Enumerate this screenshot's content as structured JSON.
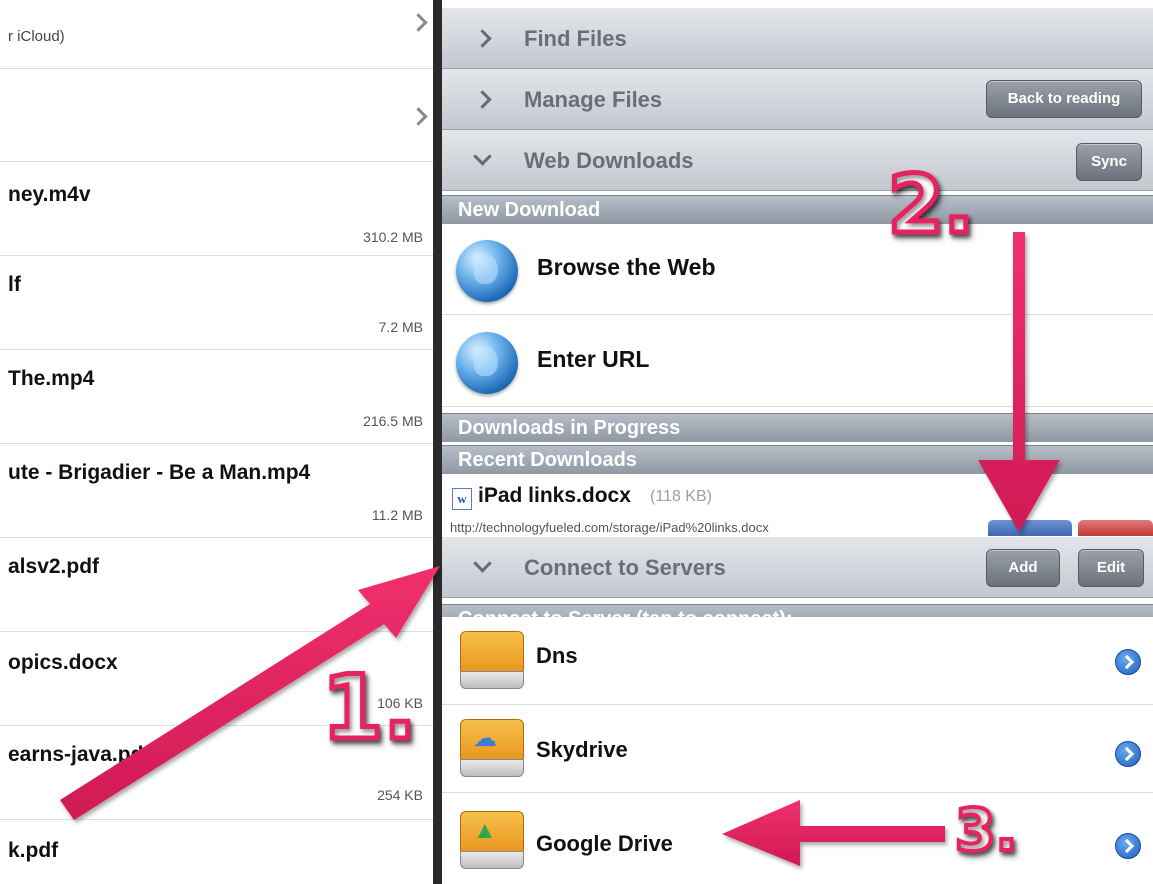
{
  "left_list": {
    "rows": [
      {
        "title": "",
        "sub": "r iCloud)",
        "size": "",
        "chevron": true
      },
      {
        "title": "",
        "sub": "",
        "size": "",
        "chevron": true
      },
      {
        "title": "ney.m4v",
        "sub": "",
        "size": "310.2 MB",
        "chevron": false
      },
      {
        "title": "lf",
        "sub": "",
        "size": "7.2 MB",
        "chevron": false
      },
      {
        "title": "The.mp4",
        "sub": "",
        "size": "216.5 MB",
        "chevron": false
      },
      {
        "title": "ute - Brigadier - Be a Man.mp4",
        "sub": "",
        "size": "11.2 MB",
        "chevron": false
      },
      {
        "title": "alsv2.pdf",
        "sub": "",
        "size": "",
        "chevron": false
      },
      {
        "title": "opics.docx",
        "sub": "",
        "size": "106 KB",
        "chevron": false
      },
      {
        "title": "earns-java.pdf",
        "sub": "",
        "size": "254 KB",
        "chevron": false
      },
      {
        "title": "k.pdf",
        "sub": "",
        "size": "",
        "chevron": false
      }
    ]
  },
  "bars": {
    "find_files": "Find Files",
    "manage_files": "Manage Files",
    "web_downloads": "Web Downloads",
    "connect_to_servers": "Connect to Servers"
  },
  "buttons": {
    "back_to_reading": "Back to reading",
    "sync": "Sync",
    "add": "Add",
    "edit": "Edit"
  },
  "sections": {
    "new_download": "New Download",
    "downloads_in_progress": "Downloads in Progress",
    "recent_downloads": "Recent Downloads",
    "connect_to_server": "Connect to Server (tap to connect):"
  },
  "web_items": {
    "browse": "Browse the Web",
    "enter_url": "Enter URL"
  },
  "recent": {
    "filename": "iPad links.docx",
    "size": "(118 KB)",
    "url": "http://technologyfueled.com/storage/iPad%20links.docx"
  },
  "servers": [
    {
      "name": "Dns",
      "icon": "folder-drive-icon"
    },
    {
      "name": "Skydrive",
      "icon": "skydrive-drive-icon"
    },
    {
      "name": "Google Drive",
      "icon": "google-drive-icon"
    }
  ],
  "callouts": {
    "one": "1.",
    "two": "2.",
    "three": "3."
  },
  "colors": {
    "annotation": "#e8245f",
    "bar_label": "#6a6f76",
    "button": "#7b828b"
  }
}
